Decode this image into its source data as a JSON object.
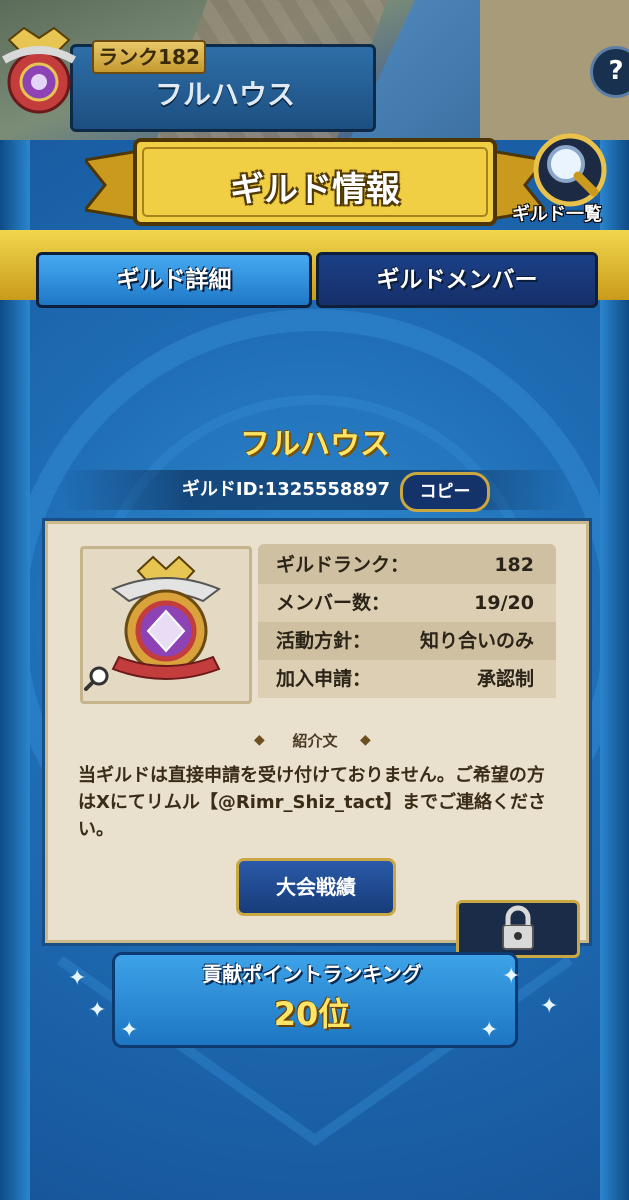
{
  "header": {
    "rank_label": "ランク182",
    "player_name": "フルハウス",
    "help_label": "?"
  },
  "title": "ギルド情報",
  "guild_list_label": "ギルド一覧",
  "tabs": [
    {
      "label": "ギルド詳細",
      "active": true
    },
    {
      "label": "ギルドメンバー",
      "active": false
    }
  ],
  "guild": {
    "name": "フルハウス",
    "id_text": "ギルドID:1325558897",
    "copy_label": "コピー",
    "stats": [
      {
        "label": "ギルドランク：",
        "value": "182"
      },
      {
        "label": "メンバー数：",
        "value": "19/20"
      },
      {
        "label": "活動方針：",
        "value": "知り合いのみ"
      },
      {
        "label": "加入申請：",
        "value": "承認制"
      }
    ],
    "intro_title": "紹介文",
    "intro_text": "当ギルドは直接申請を受け付けておりません。ご希望の方はXにてリムル【@Rimr_Shiz_tact】までご連絡ください。",
    "tournament_label": "大会戦績"
  },
  "ranking": {
    "label": "貢献ポイントランキング",
    "value": "20位"
  },
  "colors": {
    "accent_gold": "#e8c24a",
    "panel_blue": "#1f6db5",
    "parchment": "#e9e1cd"
  },
  "icons": [
    "help-icon",
    "search-icon",
    "magnifier-icon",
    "lock-icon",
    "chevron-left-icon",
    "chevron-right-icon",
    "sparkle-icon"
  ]
}
